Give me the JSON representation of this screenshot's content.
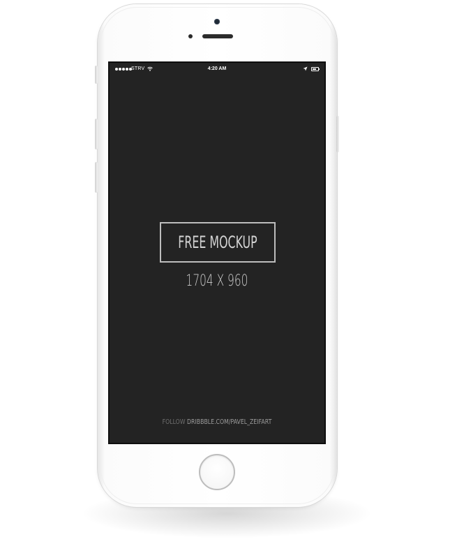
{
  "status_bar": {
    "carrier": "STRV",
    "time": "4:20 AM",
    "signal_bars_filled": 5,
    "battery_level": 0.75
  },
  "mockup": {
    "title": "FREE MOCKUP",
    "dimensions": "1704 X 960",
    "credit_prefix": "FOLLOW",
    "credit_link": "DRIBBBLE.COM/PAVEL_ZEIFART"
  },
  "icons": {
    "wifi": "wifi-icon",
    "location": "location-arrow-icon",
    "battery": "battery-icon"
  },
  "colors": {
    "screen_background": "#232323",
    "phone_body": "#ffffff",
    "text_primary": "#d4d4d4",
    "text_muted": "#6f6f6f"
  }
}
